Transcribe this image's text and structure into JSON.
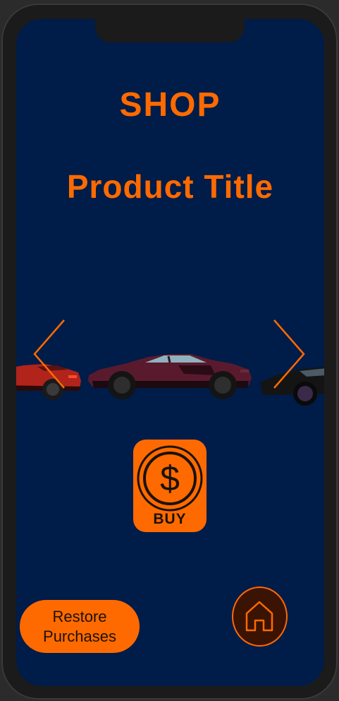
{
  "screen": {
    "shop_title": "SHOP",
    "product_title": "Product Title"
  },
  "carousel": {
    "prev_icon": "chevron-left-icon",
    "next_icon": "chevron-right-icon",
    "items": [
      {
        "name": "car-red",
        "color": "#b0241c"
      },
      {
        "name": "car-purple",
        "color": "#5a1a2e"
      },
      {
        "name": "car-black",
        "color": "#141414"
      }
    ]
  },
  "buy": {
    "label": "BUY",
    "icon": "dollar-coin-icon"
  },
  "footer": {
    "restore_label": "Restore Purchases",
    "home_icon": "home-icon"
  },
  "colors": {
    "background": "#001c48",
    "accent": "#ff6a00",
    "home_fill": "#3b1303",
    "frame": "#1b1b1b"
  }
}
